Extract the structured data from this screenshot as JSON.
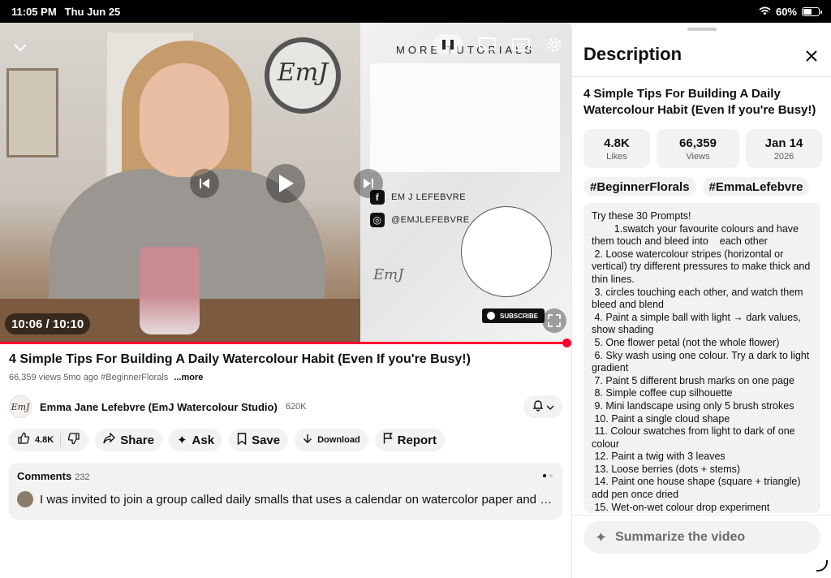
{
  "status_bar": {
    "time": "11:05 PM",
    "date": "Thu Jun 25",
    "battery": "60%",
    "battery_level": 0.6
  },
  "video": {
    "overlay_text": "MORE TUTORIALS",
    "brand_logo": "EmJ",
    "social_facebook": "EM J LEFEBVRE",
    "social_instagram": "@EMJLEFEBVRE",
    "subscribe_label": "SUBSCRIBE",
    "time": "10:06 / 10:10",
    "progress": 0.993,
    "icons": [
      "chevron-down-icon",
      "pause-icon",
      "cast-icon",
      "cc-icon",
      "gear-icon",
      "skip-previous-icon",
      "play-icon",
      "skip-next-icon",
      "fullscreen-icon"
    ]
  },
  "info": {
    "title": "4 Simple Tips For Building A Daily Watercolour Habit (Even If you're Busy!)",
    "meta": "66,359 views  5mo ago  #BeginnerFlorals",
    "more_label": "...more",
    "channel_name": "Emma Jane Lefebvre (EmJ Watercolour Studio)",
    "subscribers": "620K",
    "avatar_text": "EmJ"
  },
  "actions": {
    "likes": "4.8K",
    "share": "Share",
    "ask": "Ask",
    "save": "Save",
    "download": "Download",
    "report": "Report"
  },
  "comments": {
    "label": "Comments",
    "count": "232",
    "top_comment": "I was invited to join a group called daily smalls that uses a calendar on watercolor paper and you do a painting each day. There's different prompts."
  },
  "panel": {
    "title": "Description",
    "video_title": "4 Simple Tips For Building A Daily Watercolour Habit (Even If you're Busy!)",
    "stats": [
      {
        "num": "4.8K",
        "label": "Likes"
      },
      {
        "num": "66,359",
        "label": "Views"
      },
      {
        "num": "Jan 14",
        "label": "2026"
      }
    ],
    "tags": [
      "#BeginnerFlorals",
      "#EmmaLefebvre"
    ],
    "description_lines": [
      "Try these 30 Prompts!",
      "        1.swatch your favourite colours and have them touch and bleed into    each other",
      " 2. Loose watercolour stripes (horizontal or vertical) try different pressures to make thick and thin lines.",
      " 3. circles touching each other, and watch them bleed and blend",
      " 4. Paint a simple ball with light → dark values, show shading",
      " 5. One flower petal (not the whole flower)",
      " 6. Sky wash using one colour. Try a dark to light gradient",
      " 7. Paint 5 different brush marks on one page",
      " 8. Simple coffee cup silhouette",
      " 9. Mini landscape using only 5 brush strokes",
      " 10. Paint a single cloud shape",
      " 11. Colour swatches from light to dark of one colour",
      " 12. Paint a twig with 3 leaves",
      " 13. Loose berries (dots + stems)",
      " 14. Paint one house shape (square + triangle) add pen once dried",
      " 15. Wet-on-wet colour drop experiment"
    ],
    "summarize_label": "Summarize the video"
  }
}
